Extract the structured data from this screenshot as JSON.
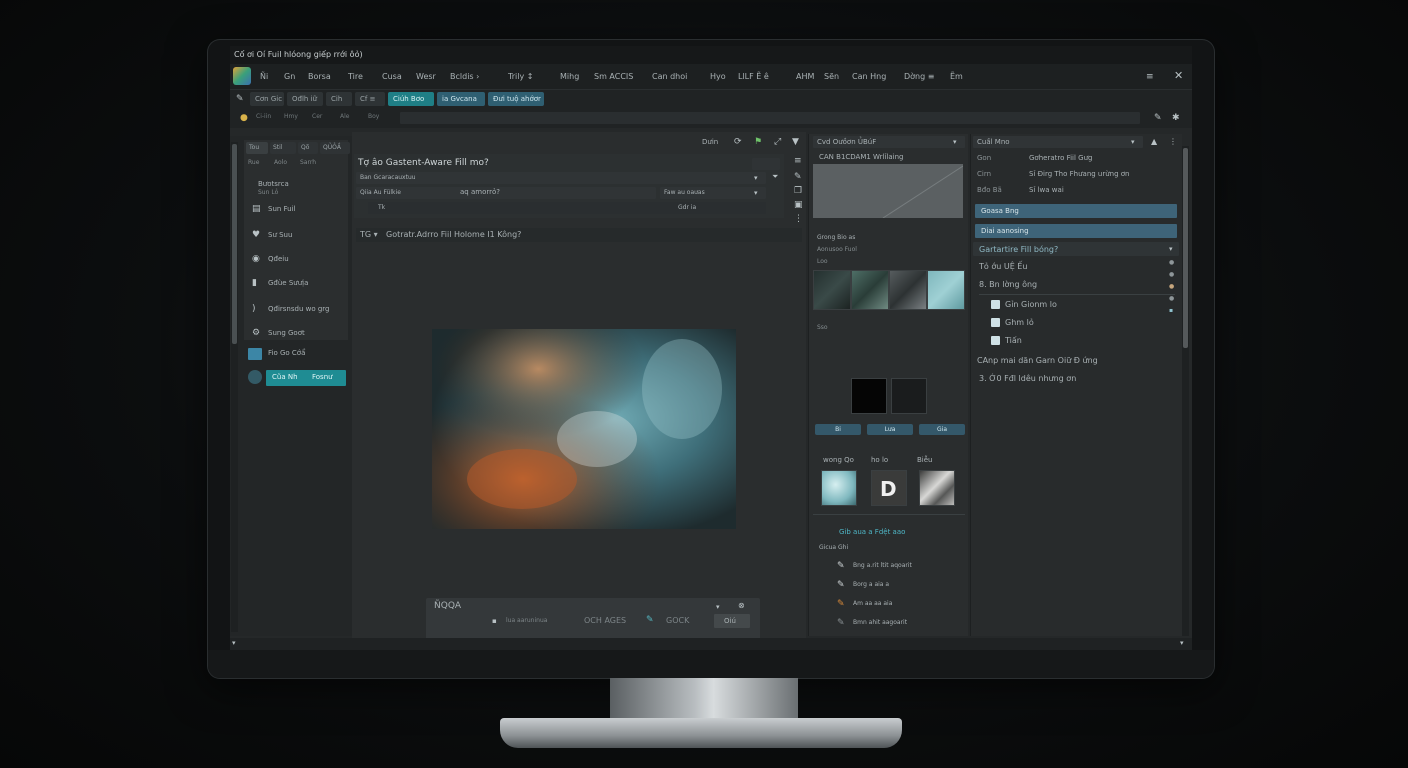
{
  "window": {
    "title": "Cố ơi Oí Fuil hlóong giếp rrới ôỏ)"
  },
  "menu": [
    "Ñi",
    "Gn",
    "Borsa",
    "Tire",
    "Cusa",
    "Wesr",
    "Bcldis ›",
    "Trily ↕",
    "Mihg",
    "Sm ACCIS",
    "Can dhoi",
    "Hyo",
    "LlLF Ẽ ê",
    "AHM",
    "Sẽn",
    "Can Hng",
    "Dờng ≡",
    "Ẽm"
  ],
  "toolbar": [
    "Cơn Gic",
    "Ođlh iữ",
    "Cih",
    "Cf ≡",
    "Ciúh Bơo",
    "ia Gvcana",
    "Đưi tuộ ahớơr"
  ],
  "addr": [
    "Ci-iin",
    "Hmy",
    "Cer",
    "Ale",
    "Boy"
  ],
  "left_panel": {
    "tabs": [
      "Tou",
      "Stil",
      "Qõ",
      "QỦỎẦ"
    ],
    "sub_tabs": [
      "Rue",
      "Aolo",
      "Sarrh"
    ],
    "section_title": "Bưotsrca",
    "section_sub": "Sun Lỏ",
    "items": [
      "Sun Fuil",
      "Sư Suu",
      "Qđeiu",
      "Gđùe Sưưịa",
      "Qđirsnsdu wo grg",
      "Sung Goơt"
    ],
    "bottom_item": "Fio Go Cớẩ",
    "teal_button_a": "Cũa Nh",
    "teal_button_b": "Fosnư"
  },
  "center": {
    "top_tools": [
      "Dưin"
    ],
    "dialog_title": "Tợ âo Gastent-Aware Fill mo?",
    "row1": "Ban Gcaracauxtuu",
    "row2_a": "Qiia Au Fülkie",
    "row2_b": "aq amorrỏ?",
    "row2_c": "Faw au oaưas",
    "row3": "Tk",
    "row3_b": "Gdr ia",
    "prompt": "Gotratr.Adrro Fiil Holome I1   Kông?",
    "prompt_prefix": "TG ▾",
    "bottom_bar_icons": "ÑQQA",
    "bottom_bar_a": "lua aaruninua",
    "bottom_bar_b": "OCH AGES",
    "bottom_bar_c": "GOCK",
    "bottom_bar_btn": "Oiú"
  },
  "mid_panel": {
    "header": "Cvd Oưồơn ỦBúF",
    "sub": "CAN B1CDAM1  Wrlỉlaing",
    "label_a": "Grong Bio as",
    "label_b": "Aonusoo Fuol",
    "label_c": "Loo",
    "label_d": "Sso",
    "buttons": [
      "Bi",
      "Lưa",
      "Gia"
    ],
    "thumb_labels": [
      "wong Qo",
      "ho lo",
      "Biễu"
    ],
    "thumb_letter": "D",
    "section_title": "Gib aua a Fdệt aao",
    "section_sub": "Gicua Ghi",
    "tools": [
      "Bng a.rit ltit aqoarit",
      "Borg a aia a",
      "Am aa aa aia",
      "Bmn ahit aagoarit"
    ]
  },
  "right_panel": {
    "header": "Cuầl Mno",
    "rows": [
      {
        "k": "Gon",
        "v": "Gơheratro Fiil Gưg"
      },
      {
        "k": "Cirn",
        "v": "Sỉ Đirg Tho Fhưang urừng ơn"
      },
      {
        "k": "Bđo Bã",
        "v": "Sỉ lwa wai"
      }
    ],
    "bar_a": "Goasa Bng",
    "bar_b": "Diai aanosing",
    "section": "Gartartire Fill bóng?",
    "list_top": "Tỏ ớu UỆ Ếu",
    "list_a": "8. Bn lờng ông",
    "checks": [
      "Gỉn Gionm lo",
      "Ghm lỏ",
      "Tiấn"
    ],
    "note_a": "CAnp mai dăn Garn Oiữ Đ ứng",
    "note_b": "3. Ớ0 Fđl ldêu nhưng ơn"
  },
  "colors": {
    "accent": "#1f8c93",
    "panel": "#2a2d2e",
    "bar": "#3e6479"
  }
}
